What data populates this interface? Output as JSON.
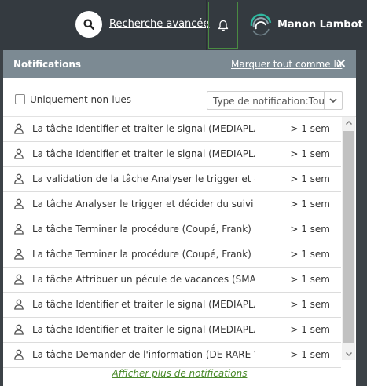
{
  "header": {
    "search_icon": "search-icon",
    "advanced_search": "Recherche avancée",
    "bell_icon": "bell-icon",
    "user_name": "Manon Lambot",
    "user_chevron": "›"
  },
  "panel": {
    "title": "Notifications",
    "mark_all_read": "Marquer tout comme lu",
    "close": "×",
    "unread_only_label": "Uniquement non-lues",
    "type_filter_value": "Type de notification:Tous",
    "show_more": "Afficher plus de notifications"
  },
  "notifications": [
    {
      "text": "La tâche Identifier et traiter le signal (MEDIAPLANET...",
      "age": "> 1 sem"
    },
    {
      "text": "La tâche Identifier et traiter le signal (MEDIAPLANET...",
      "age": "> 1 sem"
    },
    {
      "text": "La validation de la tâche Analyser le trigger et déci...",
      "age": "> 1 sem"
    },
    {
      "text": "La tâche Analyser le trigger et décider du suivi (Cou...",
      "age": "> 1 sem"
    },
    {
      "text": "La tâche Terminer la procédure (Coupé, Frank) a été...",
      "age": "> 1 sem"
    },
    {
      "text": "La tâche Terminer la procédure (Coupé, Frank) a été...",
      "age": "> 1 sem"
    },
    {
      "text": "La tâche Attribuer un pécule de vacances (SMALS A...",
      "age": "> 1 sem"
    },
    {
      "text": "La tâche Identifier et traiter le signal (MEDIAPLANET...",
      "age": "> 1 sem"
    },
    {
      "text": "La tâche Identifier et traiter le signal (MEDIAPLANET...",
      "age": "> 1 sem"
    },
    {
      "text": "La tâche Demander de l'information (DE RARE VOS ...",
      "age": "> 1 sem"
    }
  ],
  "colors": {
    "topbar": "#343a40",
    "panel_header": "#7c8a93",
    "link_green": "#4a8a2a"
  }
}
